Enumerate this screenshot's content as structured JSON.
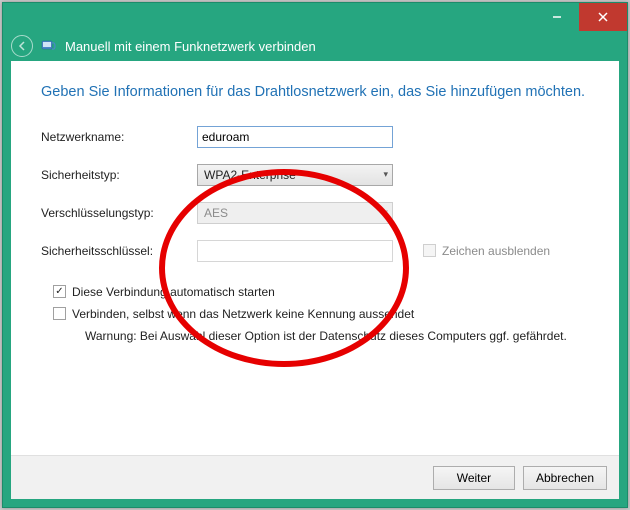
{
  "window": {
    "title": "Manuell mit einem Funknetzwerk verbinden"
  },
  "heading": "Geben Sie Informationen für das Drahtlosnetzwerk ein, das Sie hinzufügen möchten.",
  "labels": {
    "network_name": "Netzwerkname:",
    "security_type": "Sicherheitstyp:",
    "encryption_type": "Verschlüsselungstyp:",
    "security_key": "Sicherheitsschlüssel:",
    "hide_chars": "Zeichen ausblenden"
  },
  "values": {
    "network_name": "eduroam",
    "security_type": "WPA2-Enterprise",
    "encryption_type": "AES",
    "security_key": ""
  },
  "options": {
    "auto_start": "Diese Verbindung automatisch starten",
    "connect_hidden": "Verbinden, selbst wenn das Netzwerk keine Kennung aussendet",
    "warning": "Warnung: Bei Auswahl dieser Option ist der Datenschutz dieses Computers ggf. gefährdet."
  },
  "buttons": {
    "next": "Weiter",
    "cancel": "Abbrechen"
  }
}
